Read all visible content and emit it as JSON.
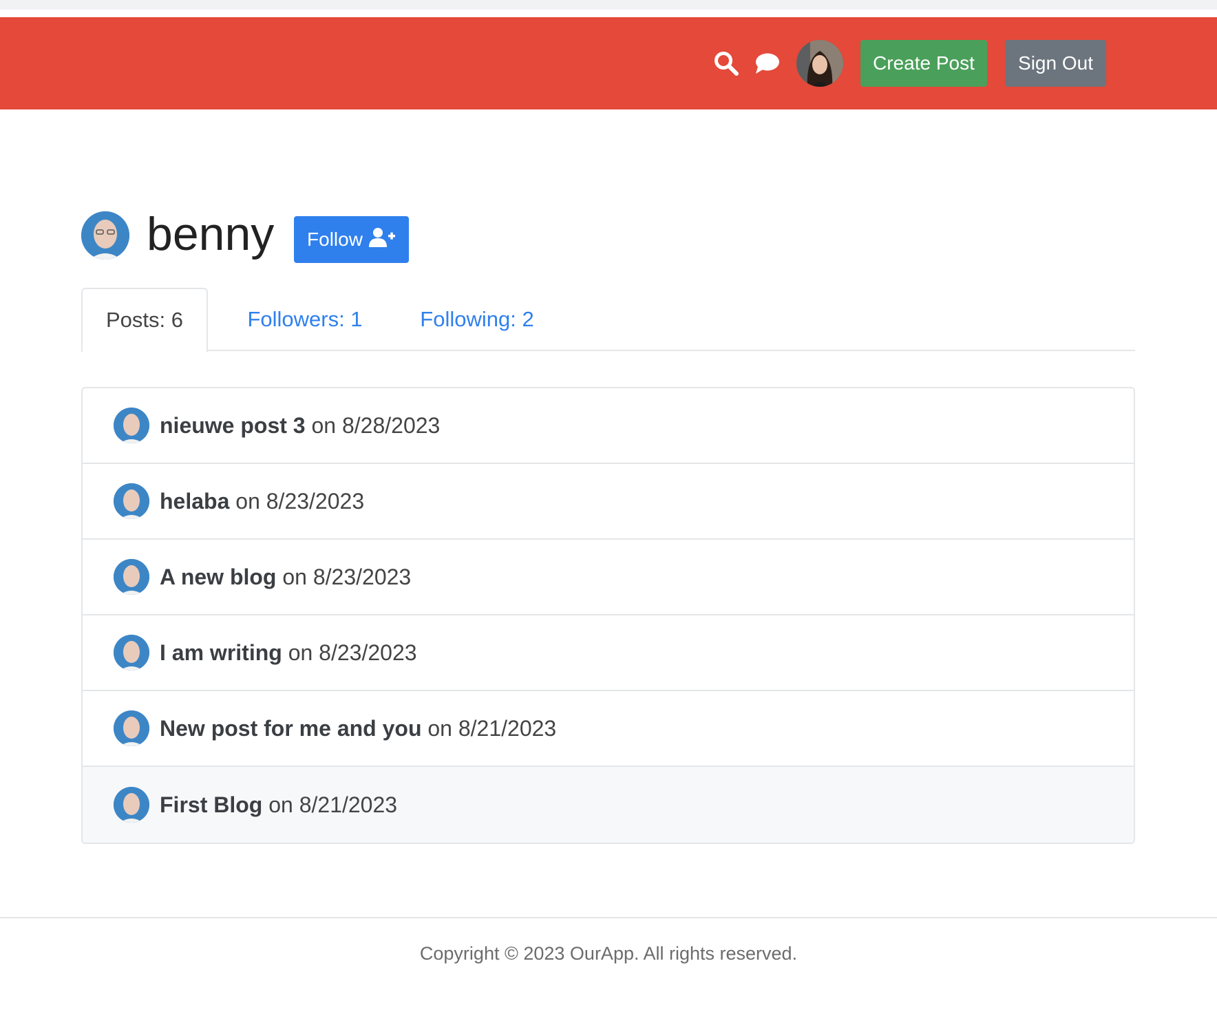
{
  "header": {
    "search_icon": "search-icon",
    "chat_icon": "chat-icon",
    "create_post_label": "Create Post",
    "sign_out_label": "Sign Out",
    "background_color": "#e4493a"
  },
  "profile": {
    "username": "benny",
    "follow_label": "Follow",
    "follow_icon": "user-plus-icon"
  },
  "tabs": [
    {
      "label": "Posts: 6",
      "active": true
    },
    {
      "label": "Followers: 1",
      "active": false
    },
    {
      "label": "Following: 2",
      "active": false
    }
  ],
  "posts": [
    {
      "title": "nieuwe post 3",
      "suffix": " on 8/28/2023"
    },
    {
      "title": "helaba",
      "suffix": " on 8/23/2023"
    },
    {
      "title": "A new blog",
      "suffix": " on 8/23/2023"
    },
    {
      "title": "I am writing",
      "suffix": " on 8/23/2023"
    },
    {
      "title": "New post for me and you",
      "suffix": " on 8/21/2023"
    },
    {
      "title": "First Blog",
      "suffix": " on 8/21/2023"
    }
  ],
  "footer": {
    "copyright": "Copyright © 2023 OurApp. All rights reserved."
  },
  "colors": {
    "accent_blue": "#2f80ed",
    "success_green": "#4aa05a",
    "secondary_gray": "#6c757d"
  }
}
